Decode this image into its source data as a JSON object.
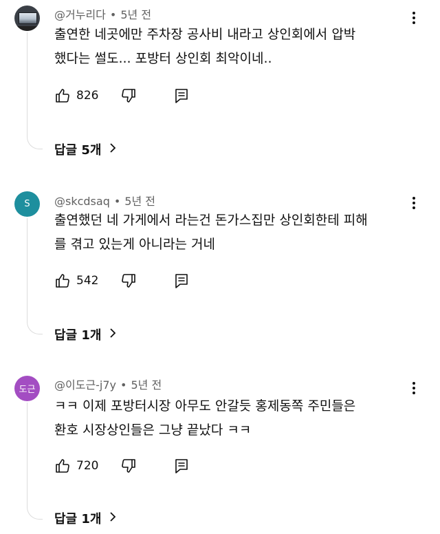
{
  "comments": [
    {
      "handle": "@거누리다",
      "time": "5년 전",
      "lines": [
        "출연한 네곳에만 주차장 공사비 내라고 상인회에서 압박",
        "했다는 썰도... 포방터 상인회 최악이네.."
      ],
      "likes": "826",
      "replies": "답글 5개",
      "avatar": {
        "type": "photo",
        "color": "#3a3f46"
      }
    },
    {
      "handle": "@skcdsaq",
      "time": "5년 전",
      "lines": [
        "출연했던 네 가게에서 라는건 돈가스집만 상인회한테 피해",
        "를 겪고 있는게 아니라는 거네"
      ],
      "likes": "542",
      "replies": "답글 1개",
      "avatar": {
        "type": "letter",
        "label": "S",
        "color": "#1e8f9e"
      }
    },
    {
      "handle": "@이도근-j7y",
      "time": "5년 전",
      "lines": [
        "ㅋㅋ 이제 포방터시장 아무도 안갈듯  홍제동쪽 주민들은",
        "환호 시장상인들은 그냥 끝났다 ㅋㅋ"
      ],
      "likes": "720",
      "replies": "답글 1개",
      "avatar": {
        "type": "letter",
        "label": "도근",
        "color": "#a34dc2"
      }
    }
  ],
  "icons": {
    "like": "thumbs-up-icon",
    "dislike": "thumbs-down-icon",
    "reply": "comment-reply-icon",
    "more": "more-vertical-icon",
    "expand": "chevron-right-icon"
  }
}
